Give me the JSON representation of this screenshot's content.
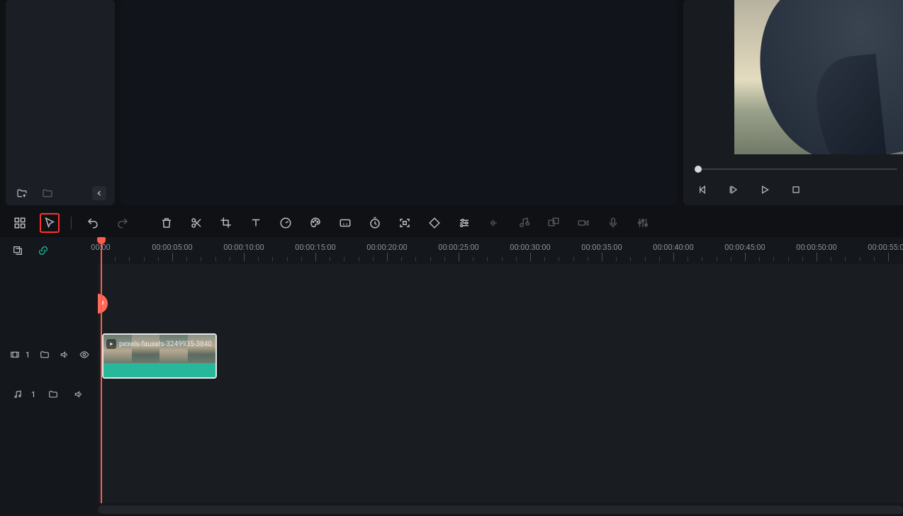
{
  "panels": {
    "left_bottom": {
      "new_folder": "new-folder",
      "folder": "folder",
      "collapse": "collapse"
    }
  },
  "preview": {
    "controls": [
      "prev-frame",
      "play-range",
      "play",
      "stop"
    ]
  },
  "toolbar": {
    "items": [
      {
        "name": "layout-grid-icon",
        "dim": false
      },
      {
        "name": "cursor-select-icon",
        "dim": false,
        "highlight": true
      },
      {
        "name": "sep"
      },
      {
        "name": "undo-icon",
        "dim": false
      },
      {
        "name": "redo-icon",
        "dim": true
      },
      {
        "name": "gap"
      },
      {
        "name": "trash-icon",
        "dim": false
      },
      {
        "name": "scissors-icon",
        "dim": false
      },
      {
        "name": "crop-icon",
        "dim": false
      },
      {
        "name": "text-icon",
        "dim": false
      },
      {
        "name": "speed-icon",
        "dim": false
      },
      {
        "name": "color-icon",
        "dim": false
      },
      {
        "name": "caption-icon",
        "dim": false
      },
      {
        "name": "timer-icon",
        "dim": false
      },
      {
        "name": "frame-fit-icon",
        "dim": false
      },
      {
        "name": "keyframe-icon",
        "dim": false
      },
      {
        "name": "adjust-icon",
        "dim": false
      },
      {
        "name": "audio-wave-icon",
        "dim": true
      },
      {
        "name": "detach-audio-icon",
        "dim": true
      },
      {
        "name": "group-icon",
        "dim": true
      },
      {
        "name": "record-icon",
        "dim": true
      },
      {
        "name": "voice-icon",
        "dim": true
      },
      {
        "name": "mix-icon",
        "dim": true
      }
    ]
  },
  "timeline": {
    "left_top_icons": [
      "stack-icon",
      "link-icon"
    ],
    "ruler_labels": [
      "00:00",
      "00:00:05:00",
      "00:00:10:00",
      "00:00:15:00",
      "00:00:20:00",
      "00:00:25:00",
      "00:00:30:00",
      "00:00:35:00",
      "00:00:40:00",
      "00:00:45:00",
      "00:00:50:00",
      "00:00:55:00"
    ],
    "tracks": [
      {
        "type": "video",
        "label": "1"
      },
      {
        "type": "audio",
        "label": "1"
      }
    ],
    "clip": {
      "title": "pexels-fauxels-3249935-3840"
    }
  }
}
